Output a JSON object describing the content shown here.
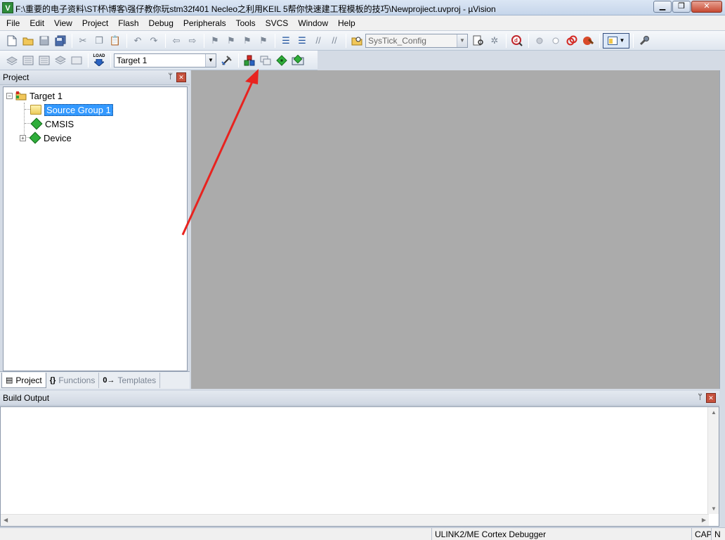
{
  "window": {
    "app_icon_letter": "V",
    "title": "F:\\重要的电子资料\\ST杯\\博客\\强仔教你玩stm32f401 Necleo之利用KEIL 5帮你快速建工程模板的技巧\\Newprojiect.uvproj - µVision",
    "minimize_glyph": "▁",
    "maximize_glyph": "❐",
    "close_glyph": "✕"
  },
  "menu": [
    "File",
    "Edit",
    "View",
    "Project",
    "Flash",
    "Debug",
    "Peripherals",
    "Tools",
    "SVCS",
    "Window",
    "Help"
  ],
  "toolbar1": {
    "find_combo": "SysTick_Config"
  },
  "toolbar2": {
    "load_label": "LOAD",
    "target_combo": "Target 1"
  },
  "project_panel": {
    "title": "Project",
    "pin_glyph": "ᛘ",
    "close_glyph": "✕",
    "tree": {
      "target": "Target 1",
      "source_group": "Source Group 1",
      "cmsis": "CMSIS",
      "device": "Device"
    },
    "tabs": [
      {
        "label": "Project",
        "icon": "▤"
      },
      {
        "label": "Functions",
        "icon": "{}"
      },
      {
        "label": "Templates",
        "icon": "0→"
      }
    ]
  },
  "build_output": {
    "title": "Build Output",
    "pin_glyph": "ᛘ",
    "close_glyph": "✕"
  },
  "statusbar": {
    "debugger": "ULINK2/ME Cortex Debugger",
    "cap": "CAP",
    "num": "N"
  },
  "colors": {
    "selection": "#3399ff",
    "editor_bg": "#ababab",
    "annotation_arrow": "#e8231f"
  }
}
